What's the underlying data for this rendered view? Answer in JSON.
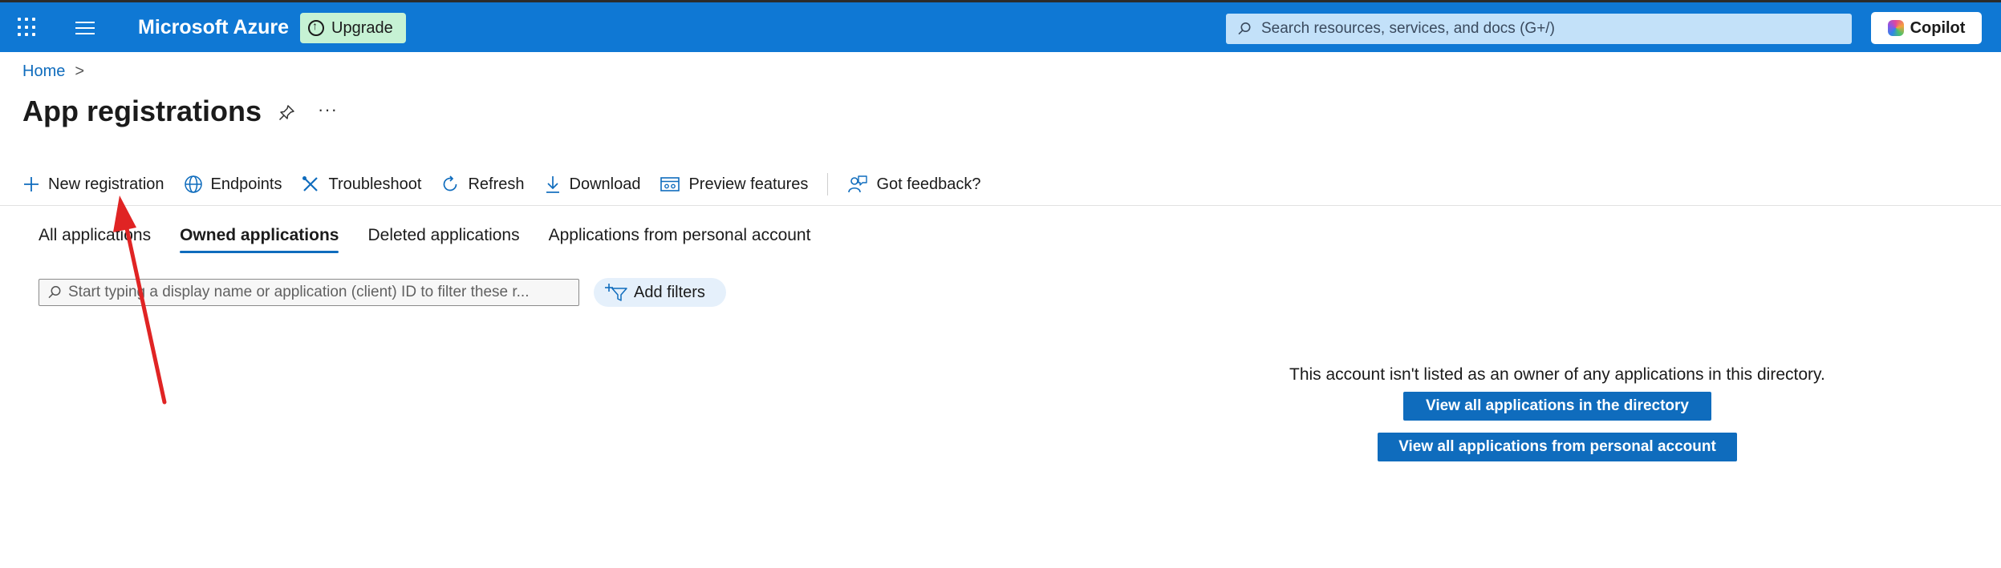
{
  "header": {
    "brand": "Microsoft Azure",
    "upgrade_label": "Upgrade",
    "search_placeholder": "Search resources, services, and docs (G+/)",
    "copilot_label": "Copilot"
  },
  "breadcrumb": {
    "home": "Home",
    "separator": ">"
  },
  "page": {
    "title": "App registrations",
    "more": "···"
  },
  "commands": [
    {
      "label": "New registration",
      "icon": "plus-icon"
    },
    {
      "label": "Endpoints",
      "icon": "globe-icon"
    },
    {
      "label": "Troubleshoot",
      "icon": "wrench-icon"
    },
    {
      "label": "Refresh",
      "icon": "refresh-icon"
    },
    {
      "label": "Download",
      "icon": "download-icon"
    },
    {
      "label": "Preview features",
      "icon": "preview-features-icon"
    },
    {
      "label": "Got feedback?",
      "icon": "feedback-icon"
    }
  ],
  "tabs": [
    {
      "label": "All applications",
      "active": false
    },
    {
      "label": "Owned applications",
      "active": true
    },
    {
      "label": "Deleted applications",
      "active": false
    },
    {
      "label": "Applications from personal account",
      "active": false
    }
  ],
  "filter": {
    "placeholder": "Start typing a display name or application (client) ID to filter these r...",
    "add_filters": "Add filters"
  },
  "empty_state": {
    "message": "This account isn't listed as an owner of any applications in this directory.",
    "view_directory": "View all applications in the directory",
    "view_personal": "View all applications from personal account"
  },
  "colors": {
    "topbar": "#0f78d4",
    "accent": "#0f6cbd",
    "upgrade_bg": "#c6f2d4",
    "annotation_arrow": "#e02424"
  }
}
